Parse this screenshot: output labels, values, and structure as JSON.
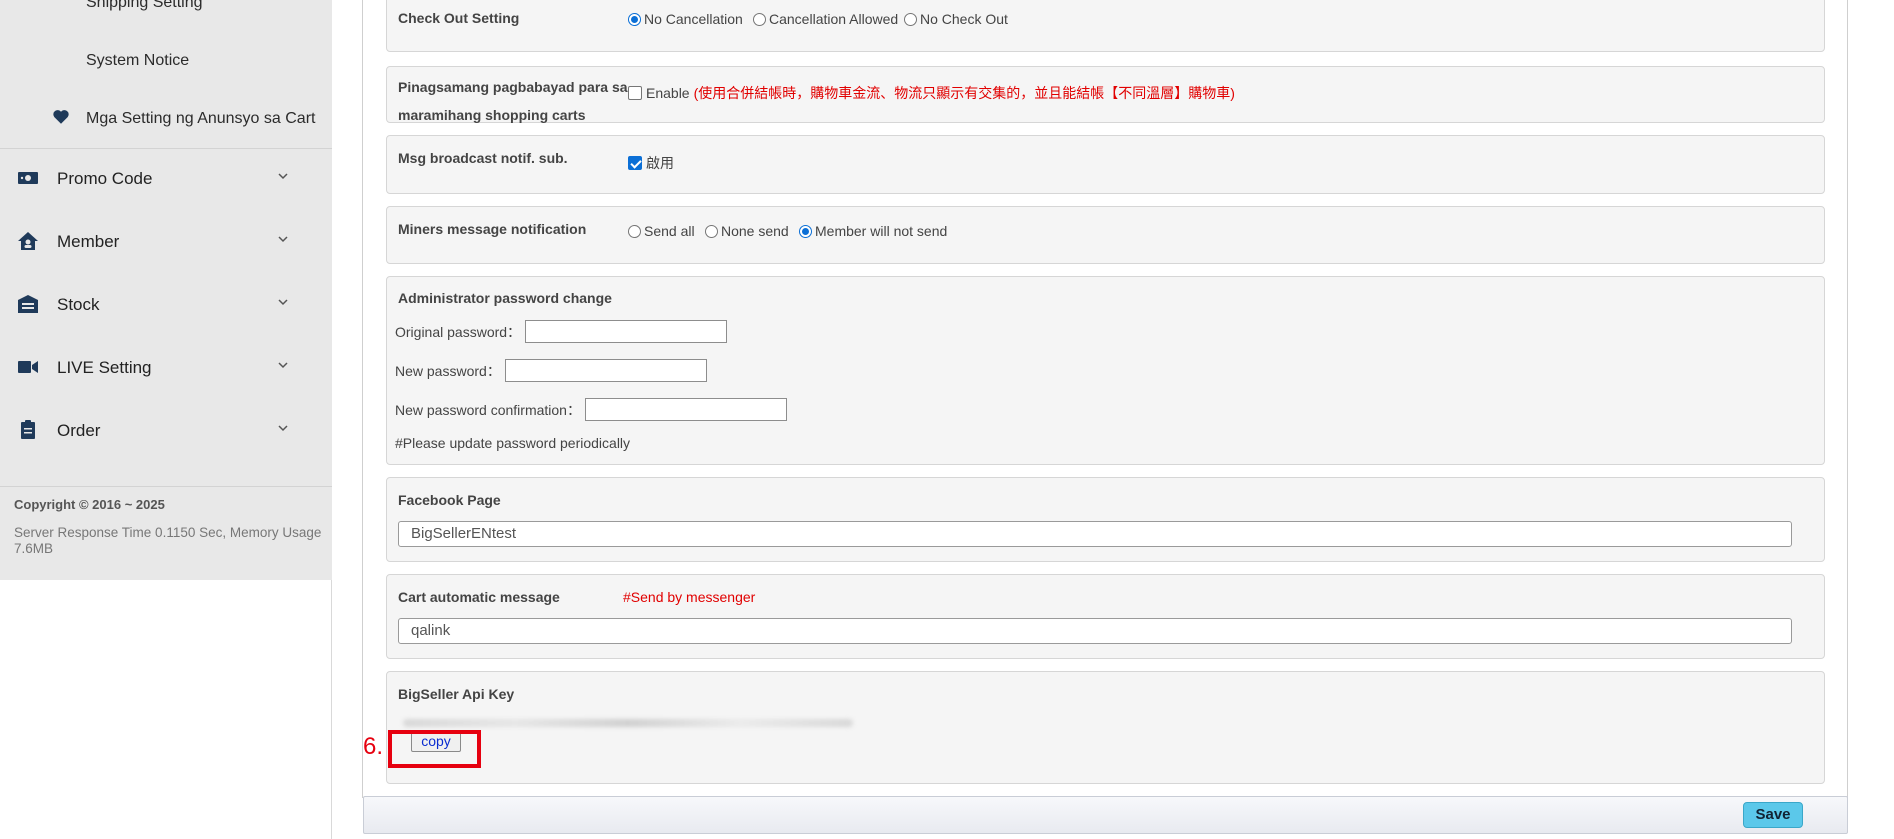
{
  "sidebar": {
    "sub_items": [
      "Shipping Setting",
      "System Notice",
      "Mga Setting ng Anunsyo sa Cart"
    ],
    "nav": [
      {
        "label": "Promo Code",
        "icon": "ticket-icon"
      },
      {
        "label": "Member",
        "icon": "home-user-icon"
      },
      {
        "label": "Stock",
        "icon": "warehouse-icon"
      },
      {
        "label": "LIVE Setting",
        "icon": "video-camera-icon"
      },
      {
        "label": "Order",
        "icon": "clipboard-icon"
      }
    ],
    "copyright": "Copyright © 2016 ~ 2025",
    "server_info": "Server Response Time 0.1150 Sec,   Memory Usage 7.6MB"
  },
  "checkout": {
    "label": "Check Out Setting",
    "options": [
      "No Cancellation",
      "Cancellation Allowed",
      "No Check Out"
    ],
    "selected": "No Cancellation"
  },
  "combined_payment": {
    "label_line1": "Pinagsamang pagbabayad para sa",
    "label_line2": "maramihang shopping carts",
    "option": "Enable",
    "note": "(使用合併結帳時，購物車金流、物流只顯示有交集的，並且能結帳【不同溫層】購物車)"
  },
  "msg_broadcast": {
    "label": "Msg broadcast notif. sub.",
    "option": "啟用",
    "checked": true
  },
  "miners": {
    "label": "Miners message notification",
    "options": [
      "Send all",
      "None send",
      "Member will not send"
    ],
    "selected": "Member will not send"
  },
  "password": {
    "title": "Administrator password change",
    "original": "Original password：",
    "new": "New password：",
    "confirm": "New password confirmation：",
    "hint": "#Please update password periodically"
  },
  "facebook": {
    "label": "Facebook Page",
    "value": "BigSellerENtest"
  },
  "cart_message": {
    "label": "Cart automatic message",
    "note": "#Send by messenger",
    "value": "qalink"
  },
  "api_key": {
    "label": "BigSeller Api Key",
    "copy_label": "copy"
  },
  "annotation": {
    "number": "6."
  },
  "footer": {
    "save_label": "Save"
  },
  "colors": {
    "accent": "#0b6fd6",
    "warning": "#e10000",
    "save": "#5bc8ea",
    "annotation": "#e6000f"
  }
}
